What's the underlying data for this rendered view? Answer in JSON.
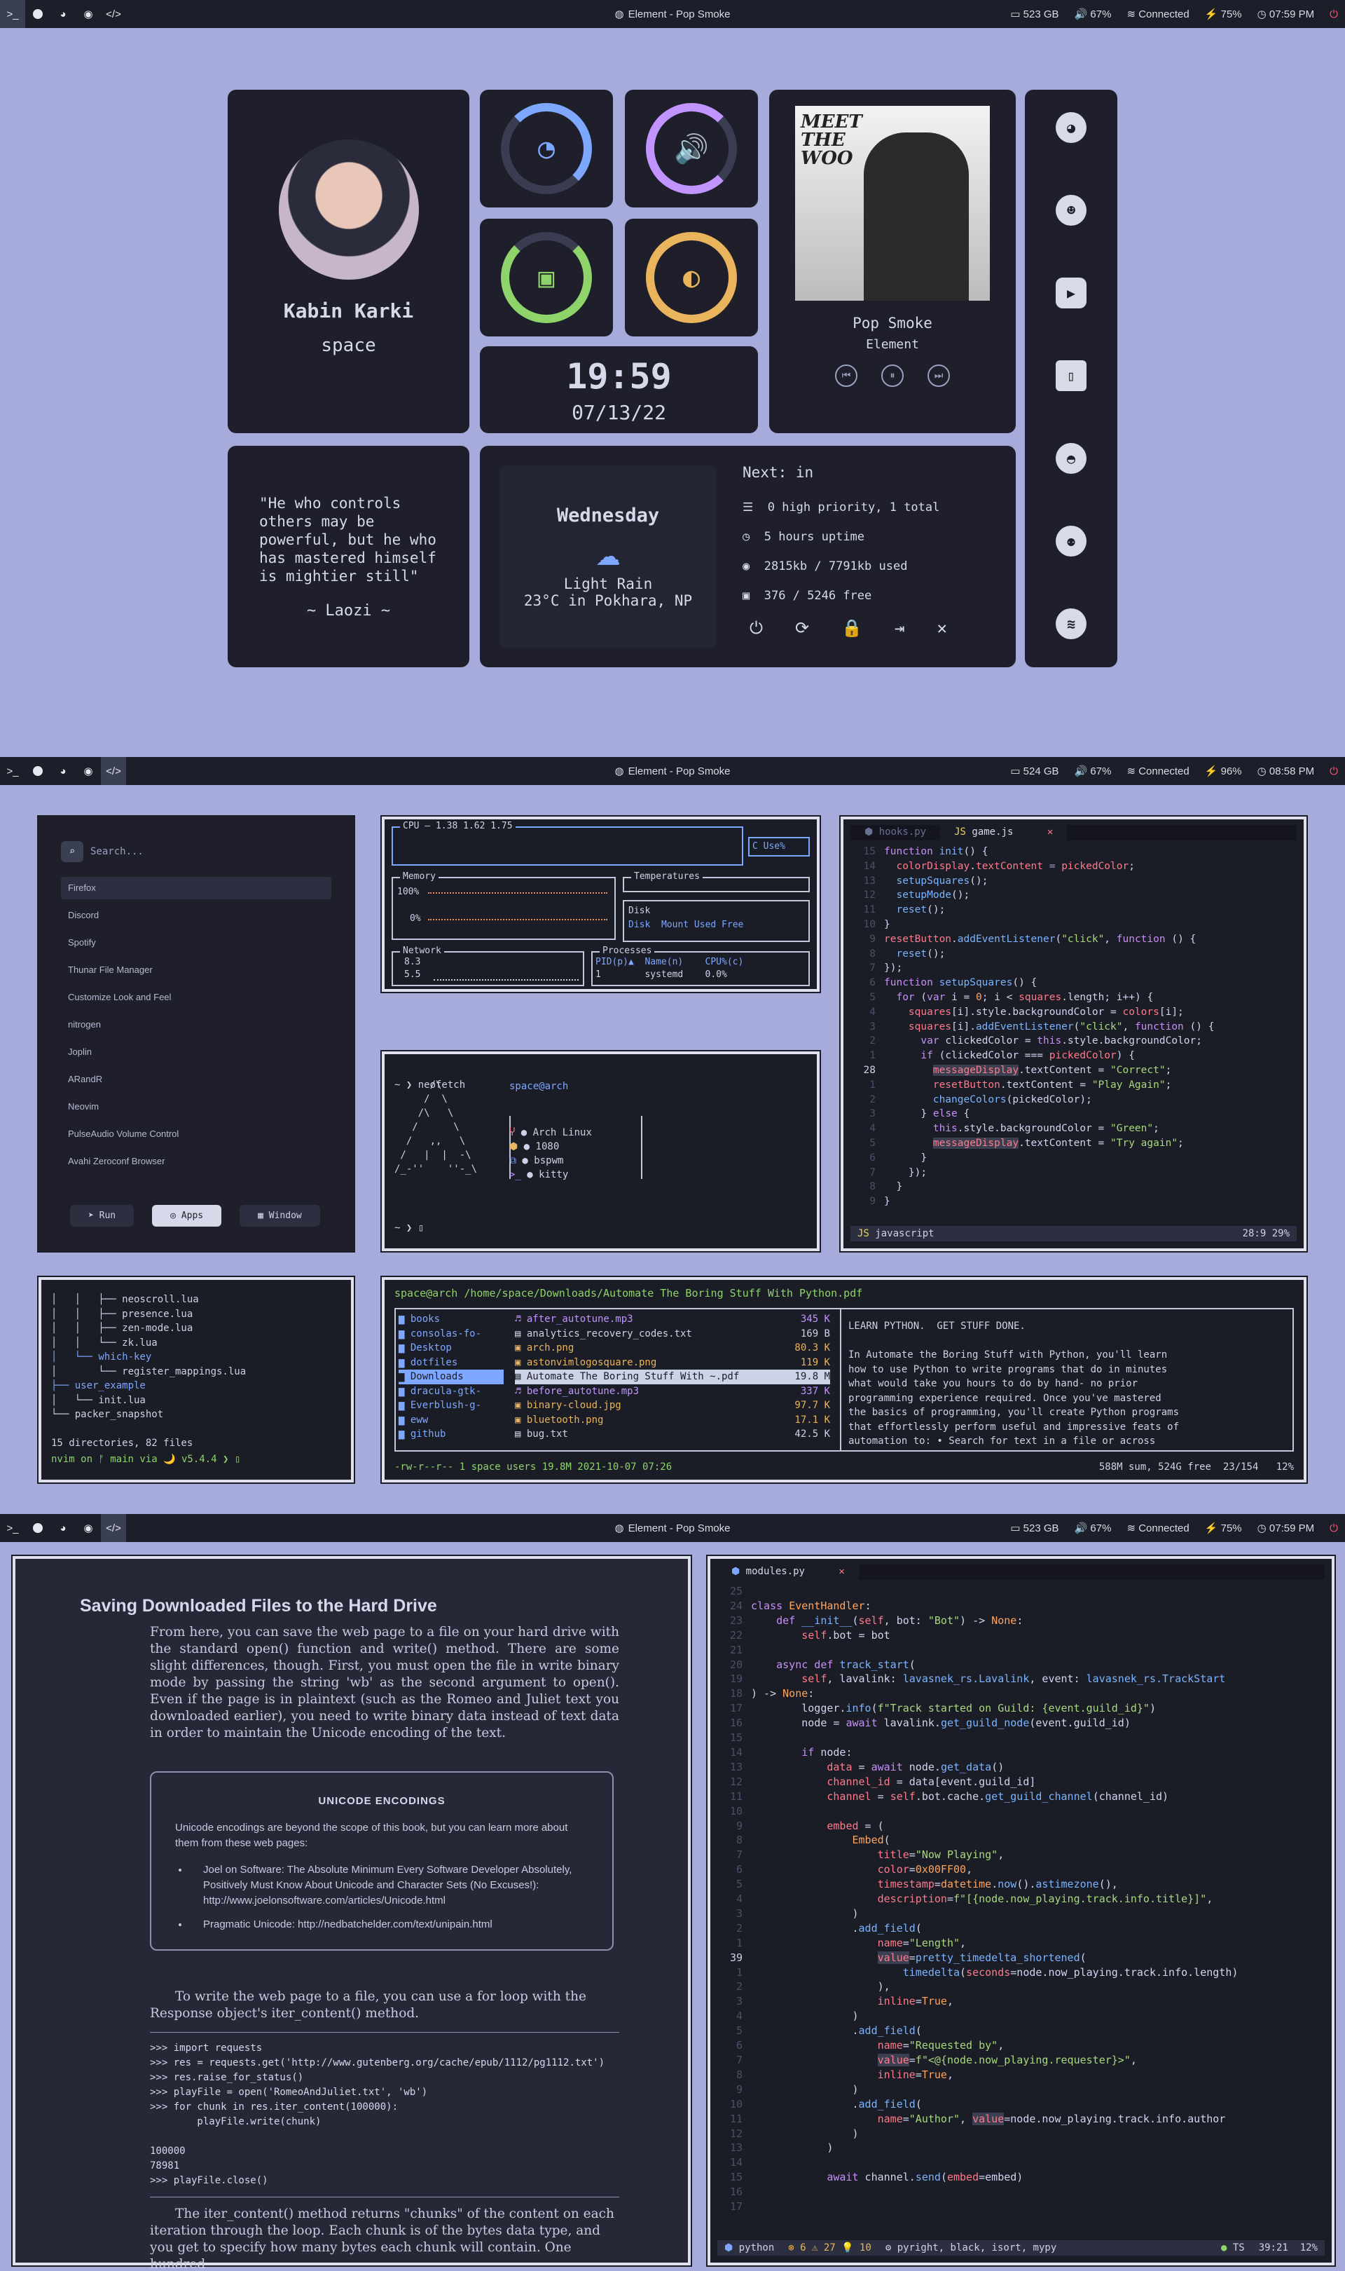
{
  "bars": [
    {
      "title": "Element - Pop Smoke",
      "disk": "523 GB",
      "vol": "67%",
      "wifi": "Connected",
      "bat": "75%",
      "time": "07:59 PM"
    },
    {
      "title": "Element - Pop Smoke",
      "disk": "524 GB",
      "vol": "67%",
      "wifi": "Connected",
      "bat": "96%",
      "time": "08:58 PM"
    },
    {
      "title": "Element - Pop Smoke",
      "disk": "523 GB",
      "vol": "67%",
      "wifi": "Connected",
      "bat": "75%",
      "time": "07:59 PM"
    }
  ],
  "profile": {
    "name": "Kabin Karki",
    "sub": "space"
  },
  "clock": {
    "time": "19:59",
    "date": "07/13/22"
  },
  "music": {
    "artist": "Pop Smoke",
    "player": "Element",
    "album_text": "MEET THE WOO"
  },
  "quote": {
    "text": "\"He who controls others may be powerful, but he who has mastered himself is mightier still\"",
    "author": "~ Laozi ~"
  },
  "weather": {
    "day": "Wednesday",
    "cond": "Light Rain",
    "temp": "23°C in Pokhara, NP"
  },
  "info": {
    "next": "Next: in",
    "tasks": "0 high priority, 1 total",
    "uptime": "5 hours uptime",
    "mem": "2815kb / 7791kb used",
    "disk": "376 / 5246 free"
  },
  "launcher": {
    "search": "Search...",
    "items": [
      "Firefox",
      "Discord",
      "Spotify",
      "Thunar File Manager",
      "Customize Look and Feel",
      "nitrogen",
      "Joplin",
      "ARandR",
      "Neovim",
      "PulseAudio Volume Control",
      "Avahi Zeroconf Browser"
    ],
    "run": "Run",
    "apps": "Apps",
    "window": "Window"
  },
  "btop": {
    "cpu": "CPU — 1.38 1.62 1.75",
    "cpuuse": "C Use%",
    "mem": "Memory",
    "p100": "100%",
    "p0": "0%",
    "temp": "Temperatures",
    "disk": "Disk",
    "diskcols": "Disk  Mount Used Free",
    "net": "Network",
    "n1": "8.3",
    "n2": "5.5",
    "proc": "Processes",
    "proccols": "PID(p)▲  Name(n)    CPU%(c)",
    "procrow": "1        systemd    0.0%"
  },
  "neofetch": {
    "prompt": "~ ❯ neofetch",
    "user": "space@arch",
    "os": "Arch Linux",
    "res": "1080",
    "wm": "bspwm",
    "term": "kitty",
    "prompt2": "~ ❯"
  },
  "tree": {
    "lines": [
      "│   │   ├── neoscroll.lua",
      "│   │   ├── presence.lua",
      "│   │   ├── zen-mode.lua",
      "│   │   └── zk.lua",
      "│   └── which-key",
      "│       └── register_mappings.lua",
      "├── user_example",
      "│   └── init.lua",
      "└── packer_snapshot",
      "",
      "15 directories, 82 files"
    ],
    "prompt": "nvim on ᚠ main via 🌙 v5.4.4 ❯"
  },
  "ranger": {
    "path": "space@arch /home/space/Downloads/Automate The Boring Stuff With Python.pdf",
    "dirs": [
      "books",
      "consolas-fo-",
      "Desktop",
      "dotfiles",
      "Downloads",
      "dracula-gtk-",
      "Everblush-g-",
      "eww",
      "github"
    ],
    "files": [
      [
        "after_autotune.mp3",
        "345 K"
      ],
      [
        "analytics_recovery_codes.txt",
        "169 B"
      ],
      [
        "arch.png",
        "80.3 K"
      ],
      [
        "astonvimlogosquare.png",
        "119 K"
      ],
      [
        "Automate The Boring Stuff With ~.pdf",
        "19.8 M"
      ],
      [
        "before_autotune.mp3",
        "337 K"
      ],
      [
        "binary-cloud.jpg",
        "97.7 K"
      ],
      [
        "bluetooth.png",
        "17.1 K"
      ],
      [
        "bug.txt",
        "42.5 K"
      ]
    ],
    "preview": [
      "LEARN PYTHON.  GET STUFF DONE.",
      "",
      "In Automate the Boring Stuff with Python, you'll learn",
      "how to use Python to write programs that do in minutes",
      "what would take you hours to do by hand- no prior",
      "programming experience required. Once you've mastered",
      "the basics of programming, you'll create Python programs",
      "that effortlessly perform useful and impressive feats of",
      "automation to: • Search for text in a file or across"
    ],
    "status": "-rw-r--r-- 1 space users 19.8M 2021-10-07 07:26",
    "status2": "588M sum, 524G free  23/154   12%"
  },
  "editor1": {
    "tab1": "hooks.py",
    "tab2": "game.js",
    "mode": "javascript",
    "pos": "28:9  29%"
  },
  "pdf": {
    "heading": "Saving Downloaded Files to the Hard Drive",
    "p1": "From here, you can save the web page to a file on your hard drive with the standard open() function and write() method. There are some slight differences, though. First, you must open the file in write binary mode by passing the string 'wb' as the second argument to open(). Even if the page is in plaintext (such as the Romeo and Juliet text you downloaded earlier), you need to write binary data instead of text data in order to maintain the Unicode encoding of the text.",
    "box_title": "UNICODE ENCODINGS",
    "box_p": "Unicode encodings are beyond the scope of this book, but you can learn more about them from these web pages:",
    "b1": "Joel on Software: The Absolute Minimum Every Software Developer Absolutely, Positively Must Know About Unicode and Character Sets (No Excuses!): http://www.joelonsoftware.com/articles/Unicode.html",
    "b2": "Pragmatic Unicode: http://nedbatchelder.com/text/unipain.html",
    "p2": "To write the web page to a file, you can use a for loop with the Response object's iter_content() method.",
    "code": [
      ">>> import requests",
      ">>> res = requests.get('http://www.gutenberg.org/cache/epub/1112/pg1112.txt')",
      ">>> res.raise_for_status()",
      ">>> playFile = open('RomeoAndJuliet.txt', 'wb')",
      ">>> for chunk in res.iter_content(100000):",
      "        playFile.write(chunk)",
      "",
      "100000",
      "78981",
      ">>> playFile.close()"
    ],
    "p3": "The iter_content() method returns \"chunks\" of the content on each iteration through the loop. Each chunk is of the bytes data type, and you get to specify how many bytes each chunk will contain. One hundred"
  },
  "editor2": {
    "tab": "modules.py",
    "lang": "python",
    "diag": "⊗ 6 ⚠ 27 💡 10",
    "tools": "pyright, black, isort, mypy",
    "ts": "TS",
    "pos": "39:21  12%"
  }
}
